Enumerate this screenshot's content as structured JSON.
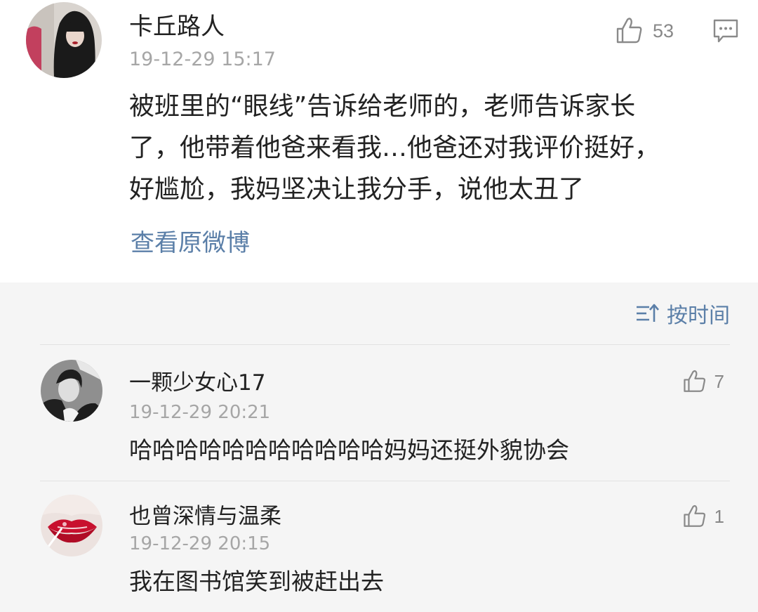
{
  "post": {
    "username": "卡丘路人",
    "time": "19-12-29 15:17",
    "like_count": "53",
    "like_icon": "thumbs-up-icon",
    "reply_icon": "comment-bubble-icon",
    "body_lines": [
      "被班里的“眼线”告诉给老师的，老师告诉家长",
      "了，他带着他爸来看我…他爸还对我评价挺好，",
      "好尴尬，我妈坚决让我分手，说他太丑了"
    ],
    "view_original": "查看原微博"
  },
  "sort": {
    "icon": "sort-icon",
    "label": "按时间"
  },
  "comments": [
    {
      "username": "一颗少女心17",
      "time": "19-12-29 20:21",
      "text": "哈哈哈哈哈哈哈哈哈哈哈妈妈还挺外貌协会",
      "like_count": "7"
    },
    {
      "username": "也曾深情与温柔",
      "time": "19-12-29 20:15",
      "text": "我在图书馆笑到被赶出去",
      "like_count": "1"
    }
  ],
  "colors": {
    "link": "#5b7fa8",
    "meta": "#a6a6a6",
    "text": "#222222",
    "background": "#f5f5f5"
  }
}
